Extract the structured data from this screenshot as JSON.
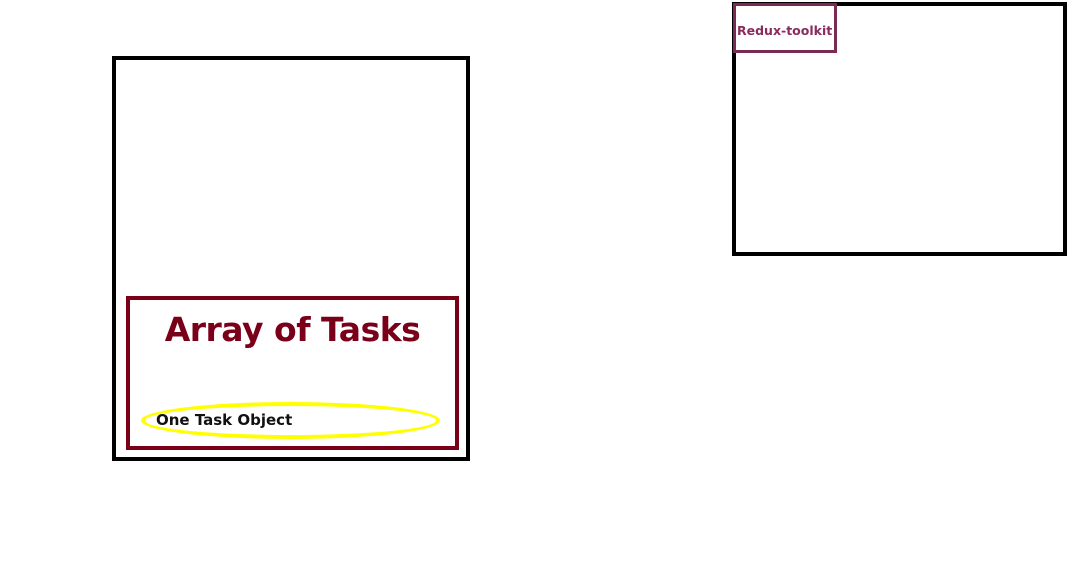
{
  "left_diagram": {
    "array_title": "Array of Tasks",
    "task_label": "One Task Object"
  },
  "right_diagram": {
    "label": "Redux-toolkit"
  },
  "colors": {
    "array_border": "#7a0019",
    "task_highlight": "#ffff00",
    "redux_border": "#7b2a55",
    "redux_text": "#8b2a5e"
  }
}
